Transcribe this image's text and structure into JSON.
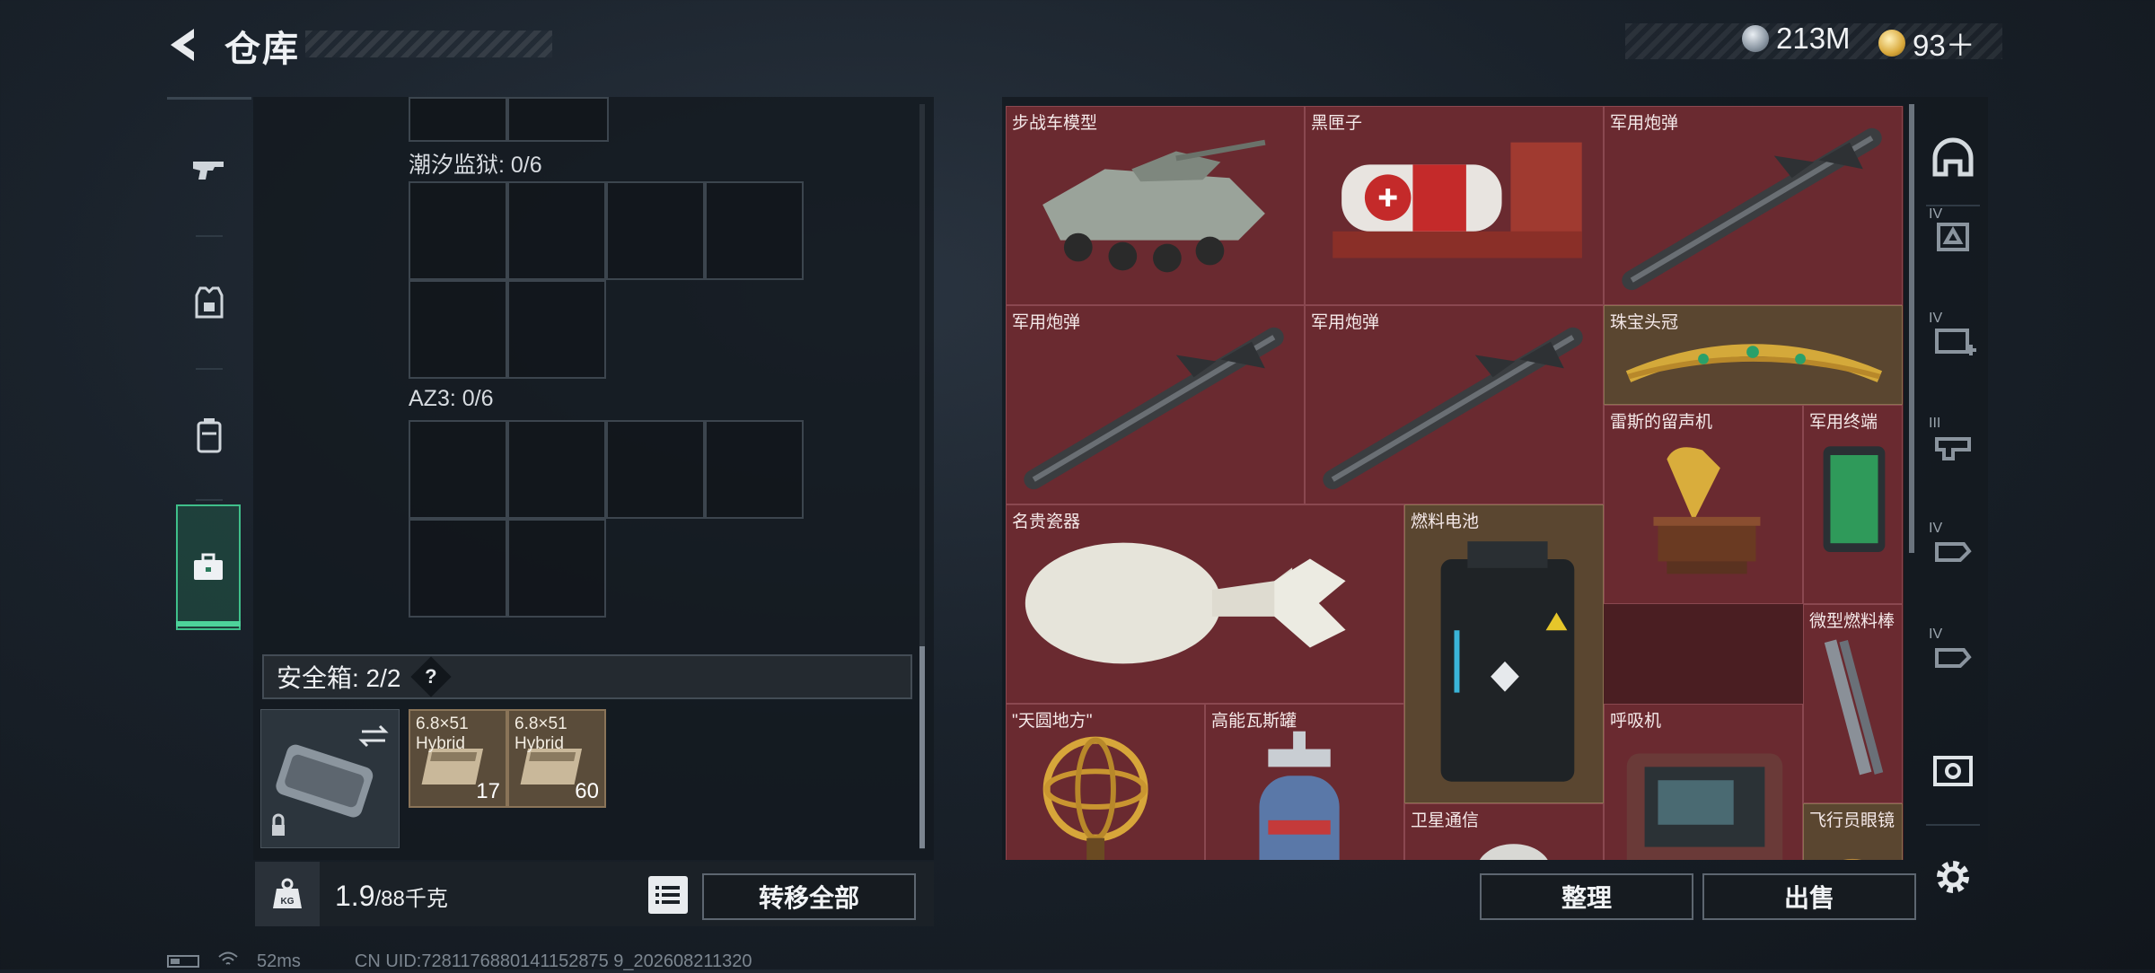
{
  "header": {
    "title": "仓库"
  },
  "currencies": {
    "silver": "213M",
    "gold": "93＋"
  },
  "left_panel": {
    "grids": [
      {
        "label": "潮汐监狱: 0/6"
      },
      {
        "label": "AZ3: 0/6"
      }
    ],
    "safebox": {
      "label": "安全箱: 2/2",
      "help": "?",
      "items": [
        {
          "name": "6.8×51\nHybrid",
          "count": "17"
        },
        {
          "name": "6.8×51\nHybrid",
          "count": "60"
        }
      ]
    },
    "weight": {
      "current": "1.9",
      "max": "/88千克",
      "icon_text": "KG"
    },
    "transfer_all_label": "转移全部"
  },
  "stash": {
    "items": [
      {
        "label": "步战车模型",
        "icon": "ifv-model-icon"
      },
      {
        "label": "黑匣子",
        "icon": "black-box-icon"
      },
      {
        "label": "军用炮弹",
        "icon": "missile-icon"
      },
      {
        "label": "军用炮弹",
        "icon": "missile-icon"
      },
      {
        "label": "军用炮弹",
        "icon": "missile-icon"
      },
      {
        "label": "珠宝头冠",
        "icon": "tiara-icon"
      },
      {
        "label": "雷斯的留声机",
        "icon": "gramophone-icon"
      },
      {
        "label": "军用终端",
        "icon": "terminal-icon"
      },
      {
        "label": "名贵瓷器",
        "icon": "porcelain-icon"
      },
      {
        "label": "燃料电池",
        "icon": "fuel-cell-icon"
      },
      {
        "label": "微型燃料棒",
        "icon": "fuel-rod-icon"
      },
      {
        "label": "\"天圆地方\"",
        "icon": "armillary-icon"
      },
      {
        "label": "高能瓦斯罐",
        "icon": "gas-tank-icon"
      },
      {
        "label": "呼吸机",
        "icon": "ventilator-icon"
      },
      {
        "label": "卫星通信",
        "icon": "satellite-icon"
      },
      {
        "label": "飞行员眼镜",
        "icon": "goggles-icon"
      }
    ],
    "organize_label": "整理",
    "sell_label": "出售"
  },
  "right_tabs": [
    {
      "icon": "helmet-filter-icon",
      "tier": ""
    },
    {
      "icon": "armor-filter-icon",
      "tier": "IV"
    },
    {
      "icon": "medical-filter-icon",
      "tier": "IV"
    },
    {
      "icon": "equipment-filter-icon",
      "tier": "III"
    },
    {
      "icon": "hand-filter-icon",
      "tier": "IV"
    },
    {
      "icon": "hand-filter-icon",
      "tier": "IV"
    },
    {
      "icon": "vault-filter-icon",
      "tier": ""
    }
  ],
  "status": {
    "ping": "52ms",
    "uid": "CN UID:7281176880141152875 9_202608211320"
  },
  "colors": {
    "accent": "#4dd39a",
    "stash_bg": "#6a2a30",
    "gold_item": "#5a4630"
  }
}
